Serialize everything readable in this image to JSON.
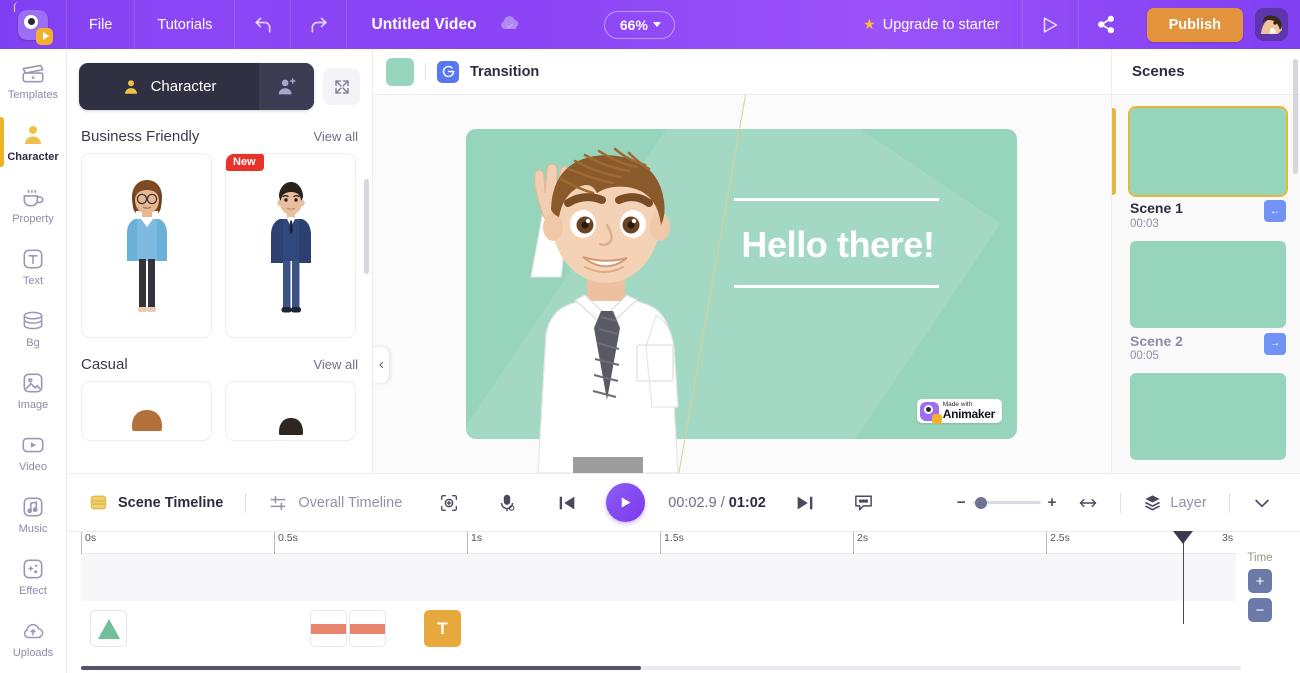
{
  "topbar": {
    "logo_name": "animaker-logo",
    "menu": [
      {
        "label": "File",
        "name": "menu-file"
      },
      {
        "label": "Tutorials",
        "name": "menu-tutorials"
      }
    ],
    "undo_icon": "undo-icon",
    "redo_icon": "redo-icon",
    "doc_title": "Untitled Video",
    "cloud_icon": "cloud-saved-icon",
    "zoom_level": "66%",
    "upgrade_label": "Upgrade to starter",
    "preview_icon": "preview-play-icon",
    "share_icon": "share-icon",
    "publish_label": "Publish",
    "avatar_name": "user-avatar",
    "accent_purple": "#8b46f5",
    "publish_orange": "#e3933b"
  },
  "rail": {
    "items": [
      {
        "label": "Templates",
        "name": "sidebar-item-templates",
        "active": false
      },
      {
        "label": "Character",
        "name": "sidebar-item-character",
        "active": true
      },
      {
        "label": "Property",
        "name": "sidebar-item-property",
        "active": false
      },
      {
        "label": "Text",
        "name": "sidebar-item-text",
        "active": false
      },
      {
        "label": "Bg",
        "name": "sidebar-item-bg",
        "active": false
      },
      {
        "label": "Image",
        "name": "sidebar-item-image",
        "active": false
      },
      {
        "label": "Video",
        "name": "sidebar-item-video",
        "active": false
      },
      {
        "label": "Music",
        "name": "sidebar-item-music",
        "active": false
      },
      {
        "label": "Effect",
        "name": "sidebar-item-effect",
        "active": false
      },
      {
        "label": "Uploads",
        "name": "sidebar-item-uploads",
        "active": false
      }
    ],
    "active_indicator_color": "#f0b323"
  },
  "library": {
    "tab_label": "Character",
    "add_character_icon": "add-person-icon",
    "expand_icon": "expand-arrows-icon",
    "sections": [
      {
        "title": "Business Friendly",
        "view_all": "View all",
        "cards": [
          {
            "name": "character-card-business-woman",
            "badge": ""
          },
          {
            "name": "character-card-business-man",
            "badge": "New"
          }
        ]
      },
      {
        "title": "Casual",
        "view_all": "View all",
        "cards": [
          {
            "name": "character-card-casual-1",
            "badge": ""
          },
          {
            "name": "character-card-casual-2",
            "badge": ""
          }
        ]
      }
    ]
  },
  "stage": {
    "swatch_color": "#97d6bd",
    "transition_icon": "transition-icon",
    "transition_label": "Transition",
    "collapse_icon": "chevron-left-icon",
    "slide": {
      "bg_color": "#96d4bc",
      "headline": "Hello there!",
      "watermark_top": "Made with",
      "watermark_brand": "Animaker"
    }
  },
  "scenes": {
    "title": "Scenes",
    "items": [
      {
        "name": "Scene 1",
        "duration": "00:03",
        "active": true,
        "arrow": "←"
      },
      {
        "name": "Scene 2",
        "duration": "00:05",
        "active": false,
        "arrow": "→"
      },
      {
        "name": "",
        "duration": "",
        "active": false,
        "arrow": ""
      }
    ],
    "thumb_color": "#96d4bc",
    "active_color": "#e8b63a"
  },
  "timeline": {
    "tab_scene": "Scene Timeline",
    "tab_overall": "Overall Timeline",
    "camera_icon": "camera-focus-icon",
    "mic_icon": "microphone-icon",
    "prev_icon": "skip-previous-icon",
    "play_icon": "play-icon",
    "next_icon": "skip-next-icon",
    "caption_icon": "caption-bubble-icon",
    "current_time": "00:02.9",
    "separator": "/",
    "total_time": "01:02",
    "fit_icon": "fit-width-icon",
    "layer_icon": "layers-icon",
    "layer_label": "Layer",
    "collapse_icon": "chevron-down-icon",
    "zoom_minus": "−",
    "zoom_plus": "+",
    "ruler_ticks": [
      "0s",
      "0.5s",
      "1s",
      "1.5s",
      "2s",
      "2.5s",
      "3s"
    ],
    "playhead_label": "playhead",
    "time_panel_label": "Time",
    "time_plus": "+",
    "time_minus": "−",
    "items": [
      {
        "name": "timeline-item-character",
        "type": "character"
      },
      {
        "name": "timeline-item-clip-1",
        "type": "bar"
      },
      {
        "name": "timeline-item-clip-2",
        "type": "bar"
      },
      {
        "name": "timeline-item-text",
        "type": "text",
        "glyph": "T"
      }
    ]
  }
}
